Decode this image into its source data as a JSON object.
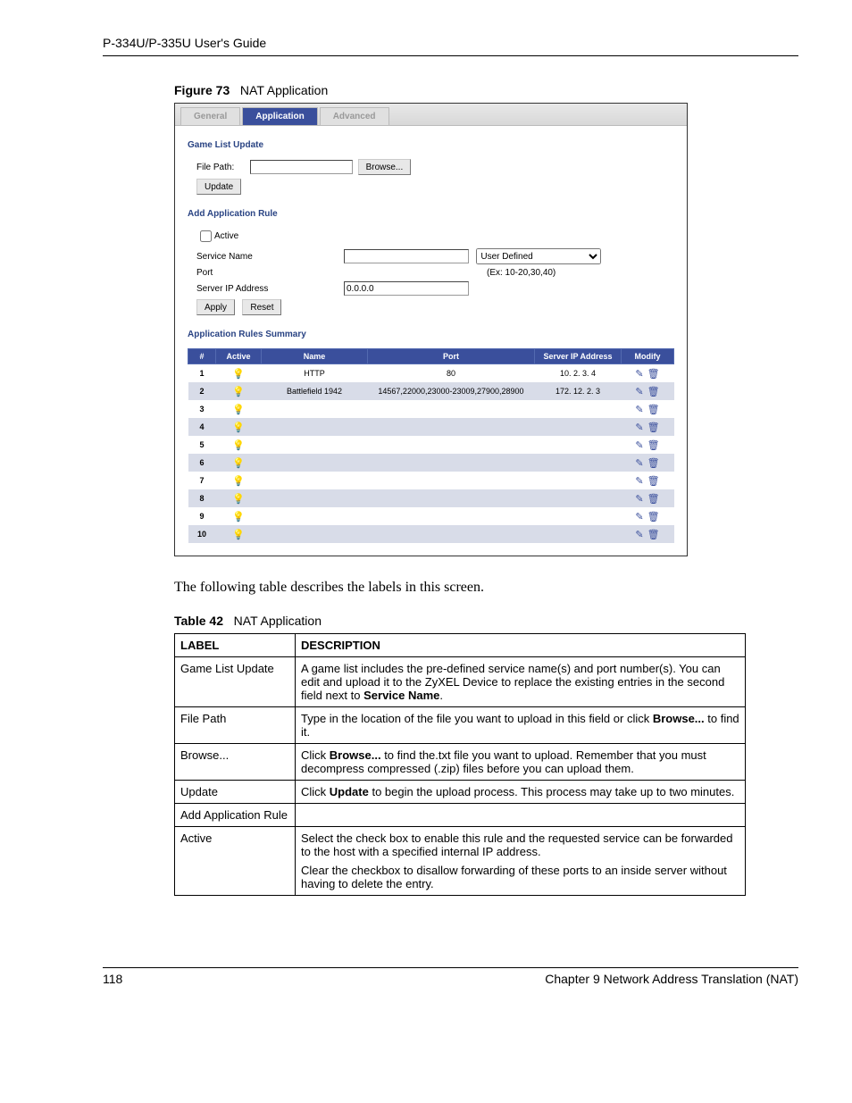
{
  "header": {
    "title": "P-334U/P-335U User's Guide"
  },
  "figure": {
    "label": "Figure 73",
    "title": "NAT Application"
  },
  "screenshot": {
    "tabs": {
      "general": "General",
      "application": "Application",
      "advanced": "Advanced"
    },
    "game_list": {
      "heading": "Game List Update",
      "file_path_label": "File Path:",
      "browse_btn": "Browse...",
      "update_btn": "Update"
    },
    "add_rule": {
      "heading": "Add Application Rule",
      "active_label": "Active",
      "service_name_label": "Service Name",
      "service_select": "User Defined",
      "port_label": "Port",
      "port_hint": "(Ex: 10-20,30,40)",
      "server_ip_label": "Server IP Address",
      "server_ip_value": "0.0.0.0",
      "apply_btn": "Apply",
      "reset_btn": "Reset"
    },
    "summary": {
      "heading": "Application Rules Summary",
      "cols": {
        "num": "#",
        "active": "Active",
        "name": "Name",
        "port": "Port",
        "server": "Server IP Address",
        "modify": "Modify"
      },
      "rows": [
        {
          "n": "1",
          "active": true,
          "name": "HTTP",
          "port": "80",
          "server": "10. 2. 3. 4"
        },
        {
          "n": "2",
          "active": true,
          "name": "Battlefield 1942",
          "port": "14567,22000,23000-23009,27900,28900",
          "server": "172. 12. 2. 3"
        },
        {
          "n": "3",
          "active": false,
          "name": "",
          "port": "",
          "server": ""
        },
        {
          "n": "4",
          "active": false,
          "name": "",
          "port": "",
          "server": ""
        },
        {
          "n": "5",
          "active": false,
          "name": "",
          "port": "",
          "server": ""
        },
        {
          "n": "6",
          "active": false,
          "name": "",
          "port": "",
          "server": ""
        },
        {
          "n": "7",
          "active": false,
          "name": "",
          "port": "",
          "server": ""
        },
        {
          "n": "8",
          "active": false,
          "name": "",
          "port": "",
          "server": ""
        },
        {
          "n": "9",
          "active": false,
          "name": "",
          "port": "",
          "server": ""
        },
        {
          "n": "10",
          "active": false,
          "name": "",
          "port": "",
          "server": ""
        }
      ]
    }
  },
  "body_text": "The following table describes the labels in this screen.",
  "table": {
    "label": "Table 42",
    "title": "NAT Application",
    "head_label": "LABEL",
    "head_desc": "DESCRIPTION",
    "rows": [
      {
        "label": "Game List Update",
        "desc_pre": "A game list includes the pre-defined service name(s) and port number(s). You can edit and upload it to the ZyXEL Device to replace the existing entries in the second field next to ",
        "b1": "Service Name",
        "desc_post": "."
      },
      {
        "label": "File Path",
        "desc_pre": "Type in the location of the file you want to upload in this field or click ",
        "b1": "Browse...",
        "desc_post": " to find it."
      },
      {
        "label": "Browse...",
        "desc_pre": "Click ",
        "b1": "Browse...",
        "desc_post": " to find the.txt file you want to upload. Remember that you must decompress compressed (.zip) files before you can upload them."
      },
      {
        "label": "Update",
        "desc_pre": "Click ",
        "b1": "Update",
        "desc_post": " to begin the upload process. This process may take up to two minutes."
      },
      {
        "label": "Add Application Rule",
        "desc_pre": "",
        "b1": "",
        "desc_post": ""
      },
      {
        "label": "Active",
        "desc_pre": "Select the check box to enable this rule and the requested service can be forwarded to the host with a specified internal IP address.",
        "b1": "",
        "desc_post": "",
        "p2": "Clear the checkbox to disallow forwarding of these ports to an inside server without having to delete the entry."
      }
    ]
  },
  "footer": {
    "page": "118",
    "chapter": "Chapter 9 Network Address Translation (NAT)"
  }
}
